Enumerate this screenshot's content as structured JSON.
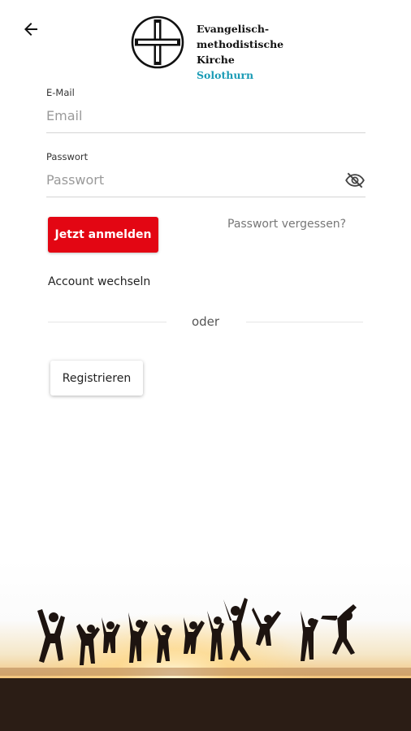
{
  "header": {
    "logo": {
      "line1": "Evangelisch-",
      "line2": "methodistische",
      "line3": "Kirche",
      "city": "Solothurn"
    }
  },
  "form": {
    "email_label": "E-Mail",
    "email_placeholder": "Email",
    "email_value": "",
    "password_label": "Passwort",
    "password_placeholder": "Passwort",
    "password_value": "",
    "login_button": "Jetzt anmelden",
    "forgot_link": "Passwort vergessen?",
    "switch_account": "Account wechseln",
    "or_text": "oder",
    "register_button": "Registrieren"
  },
  "icons": {
    "back": "arrow-left-icon",
    "visibility": "eye-off-icon"
  },
  "colors": {
    "accent_red": "#e30613",
    "brand_teal": "#1a9bb5"
  }
}
